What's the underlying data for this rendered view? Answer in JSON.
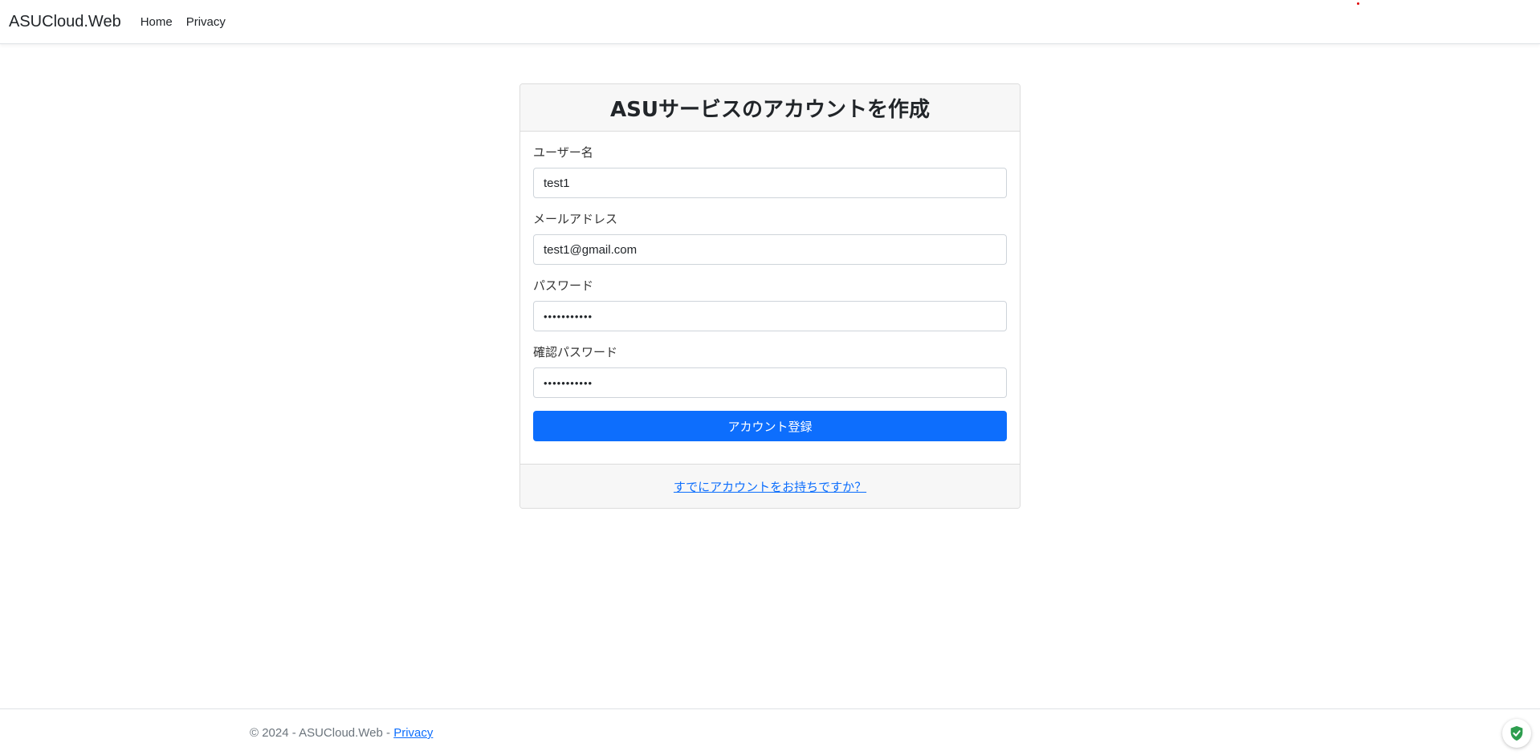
{
  "navbar": {
    "brand": "ASUCloud.Web",
    "links": [
      {
        "label": "Home"
      },
      {
        "label": "Privacy"
      }
    ]
  },
  "card": {
    "title": "ASUサービスのアカウントを作成",
    "fields": {
      "username": {
        "label": "ユーザー名",
        "value": "test1"
      },
      "email": {
        "label": "メールアドレス",
        "value": "test1@gmail.com"
      },
      "password": {
        "label": "パスワード",
        "value": "•••••••••••"
      },
      "confirm_password": {
        "label": "確認パスワード",
        "value": "•••••••••••"
      }
    },
    "submit_label": "アカウント登録",
    "login_link": "すでにアカウントをお持ちですか？"
  },
  "footer": {
    "copyright": "© 2024 - ASUCloud.Web - ",
    "privacy_link": "Privacy"
  },
  "colors": {
    "primary": "#0d6efd",
    "shield": "#2e9e4f",
    "header_bg": "#f7f7f7"
  },
  "icons": {
    "badge": "shield-check-icon"
  }
}
